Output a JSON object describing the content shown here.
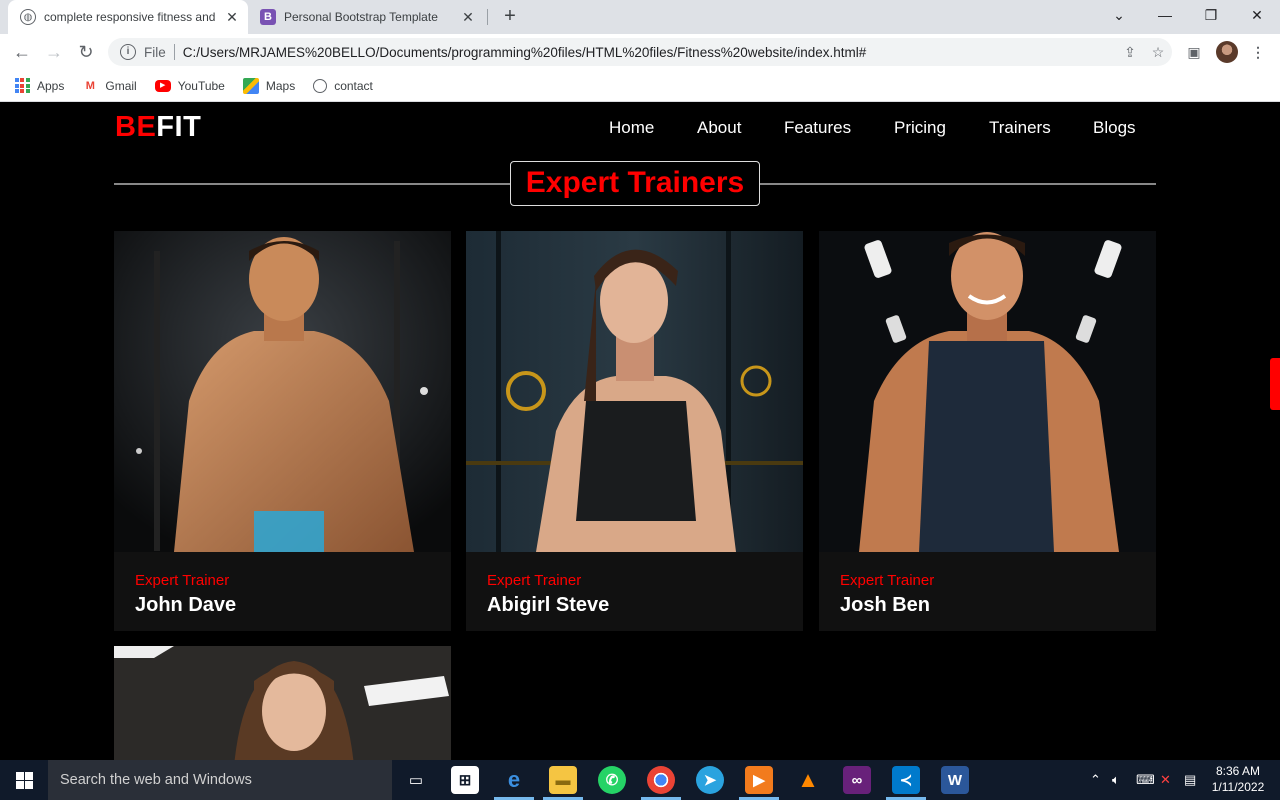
{
  "browser": {
    "tabs": [
      {
        "title": "complete responsive fitness and",
        "icon": "globe-icon",
        "active": true
      },
      {
        "title": "Personal Bootstrap Template",
        "icon": "bootstrap-icon",
        "favicon_letter": "B",
        "active": false
      }
    ],
    "new_tab_symbol": "+",
    "omnibox": {
      "scheme_label": "File",
      "url": "C:/Users/MRJAMES%20BELLO/Documents/programming%20files/HTML%20files/Fitness%20website/index.html#"
    },
    "bookmarks": [
      {
        "label": "Apps",
        "icon": "apps-grid-icon"
      },
      {
        "label": "Gmail",
        "icon": "gmail-icon"
      },
      {
        "label": "YouTube",
        "icon": "youtube-icon"
      },
      {
        "label": "Maps",
        "icon": "maps-icon"
      },
      {
        "label": "contact",
        "icon": "globe-icon"
      }
    ]
  },
  "site": {
    "logo": {
      "part1": "BE",
      "part2": "FIT"
    },
    "nav": [
      "Home",
      "About",
      "Features",
      "Pricing",
      "Trainers",
      "Blogs"
    ],
    "section_title": "Expert Trainers",
    "trainers": [
      {
        "role": "Expert Trainer",
        "name": "John Dave"
      },
      {
        "role": "Expert Trainer",
        "name": "Abigirl Steve"
      },
      {
        "role": "Expert Trainer",
        "name": "Josh Ben"
      }
    ],
    "colors": {
      "accent": "#ff0000",
      "background": "#000000",
      "card": "#111111"
    }
  },
  "taskbar": {
    "search_placeholder": "Search the web and Windows",
    "time": "8:36 AM",
    "date": "1/11/2022",
    "apps": [
      "task-view-icon",
      "store-icon",
      "edge-icon",
      "file-explorer-icon",
      "whatsapp-icon",
      "chrome-icon",
      "telegram-icon",
      "media-player-icon",
      "vlc-icon",
      "visual-studio-icon",
      "vscode-icon",
      "word-icon"
    ]
  }
}
